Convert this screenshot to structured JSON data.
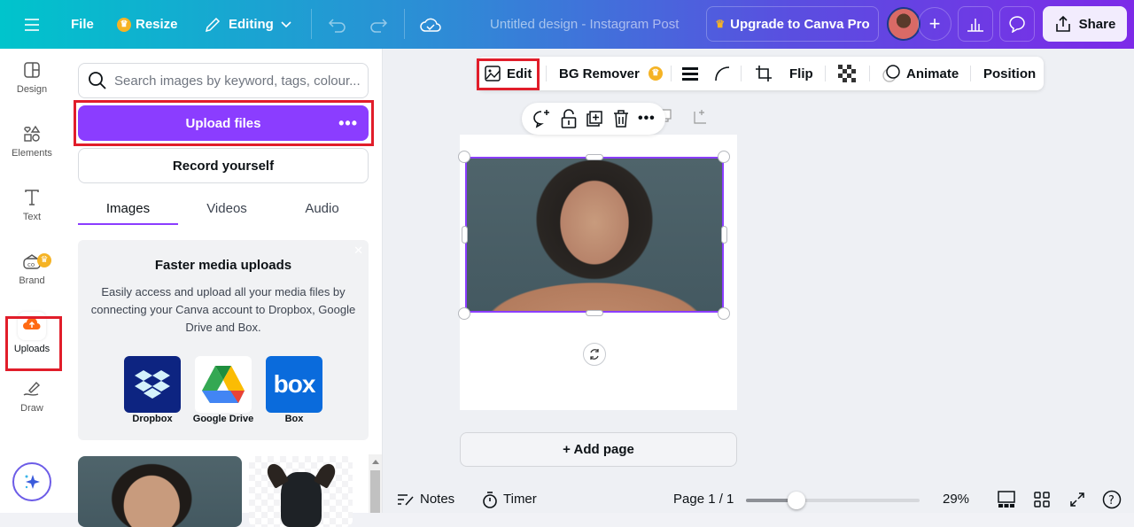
{
  "topbar": {
    "file": "File",
    "resize": "Resize",
    "editing": "Editing",
    "title": "Untitled design - Instagram Post",
    "upgrade": "Upgrade to Canva Pro",
    "share": "Share"
  },
  "leftnav": {
    "items": [
      {
        "label": "Design",
        "icon": "design-icon"
      },
      {
        "label": "Elements",
        "icon": "elements-icon"
      },
      {
        "label": "Text",
        "icon": "text-icon"
      },
      {
        "label": "Brand",
        "icon": "brand-icon"
      },
      {
        "label": "Uploads",
        "icon": "upload-cloud-icon",
        "active": true
      },
      {
        "label": "Draw",
        "icon": "draw-icon"
      }
    ]
  },
  "panel": {
    "search_placeholder": "Search images by keyword, tags, colour...",
    "upload_button": "Upload files",
    "record_button": "Record yourself",
    "tabs": [
      {
        "label": "Images",
        "active": true
      },
      {
        "label": "Videos"
      },
      {
        "label": "Audio"
      }
    ],
    "promo": {
      "title": "Faster media uploads",
      "body": "Easily access and upload all your media files by connecting your Canva account to Dropbox, Google Drive and Box.",
      "services": [
        {
          "label": "Dropbox",
          "color": "#0d2481"
        },
        {
          "label": "Google Drive",
          "color": "#ffffff"
        },
        {
          "label": "Box",
          "color": "#0a6bdc"
        }
      ]
    }
  },
  "context_toolbar": {
    "edit": "Edit",
    "bg_remover": "BG Remover",
    "flip": "Flip",
    "animate": "Animate",
    "position": "Position"
  },
  "canvas": {
    "add_page": "+ Add page"
  },
  "footer": {
    "notes": "Notes",
    "timer": "Timer",
    "page": "Page 1 / 1",
    "zoom_percent": "29%",
    "zoom_slider_fraction": 0.29
  },
  "colors": {
    "accent": "#8b3dff",
    "highlight": "#e11d2a",
    "uploads_icon": "#ff6a13",
    "crown": "#f5b324"
  }
}
